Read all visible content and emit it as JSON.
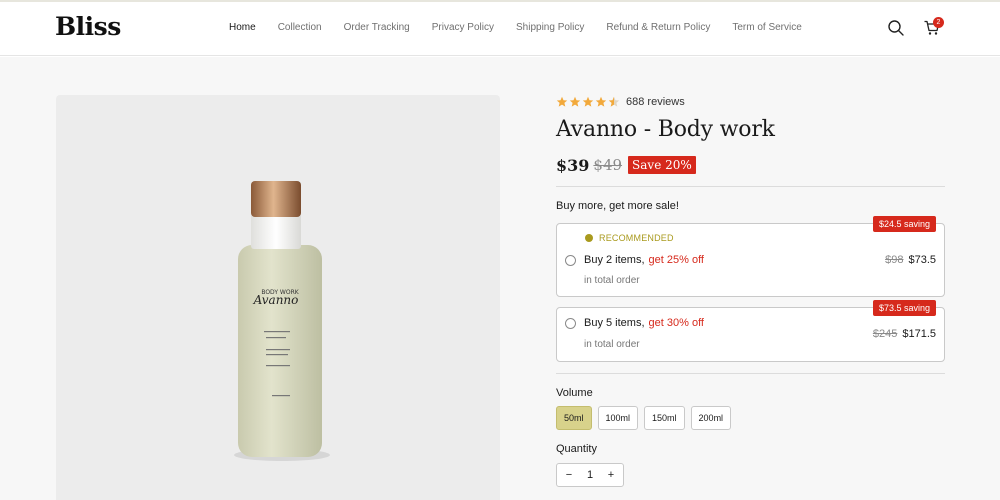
{
  "brand": {
    "logo": "Bliss"
  },
  "nav": {
    "items": [
      "Home",
      "Collection",
      "Order Tracking",
      "Privacy Policy",
      "Shipping Policy",
      "Refund & Return Policy",
      "Term of Service"
    ],
    "active": "Home"
  },
  "header": {
    "cart_count": "2",
    "icons": [
      "search-icon",
      "cart-icon"
    ]
  },
  "product": {
    "rating": 4.5,
    "reviews": "688 reviews",
    "title": "Avanno - Body work",
    "price": "$39",
    "compare_price": "$49",
    "save_badge": "Save 20%",
    "image_label": {
      "line1": "BODY WORK",
      "line2": "Avanno"
    }
  },
  "bundle": {
    "heading": "Buy more, get more sale!",
    "offers": [
      {
        "recommended": "RECOMMENDED",
        "label": "Buy 2 items,",
        "deal": "get 25% off",
        "sub": "in total order",
        "old_price": "$98",
        "new_price": "$73.5",
        "saving": "$24.5 saving"
      },
      {
        "label": "Buy 5 items,",
        "deal": "get 30% off",
        "sub": "in total order",
        "old_price": "$245",
        "new_price": "$171.5",
        "saving": "$73.5 saving"
      }
    ]
  },
  "volume": {
    "label": "Volume",
    "options": [
      "50ml",
      "100ml",
      "150ml",
      "200ml"
    ],
    "selected": "50ml"
  },
  "quantity": {
    "label": "Quantity",
    "value": "1",
    "minus": "−",
    "plus": "+"
  },
  "colors": {
    "accent_red": "#d6291c",
    "selected_volume": "#d8d28b",
    "recommended": "#a99a1e",
    "star": "#f2a93b"
  }
}
